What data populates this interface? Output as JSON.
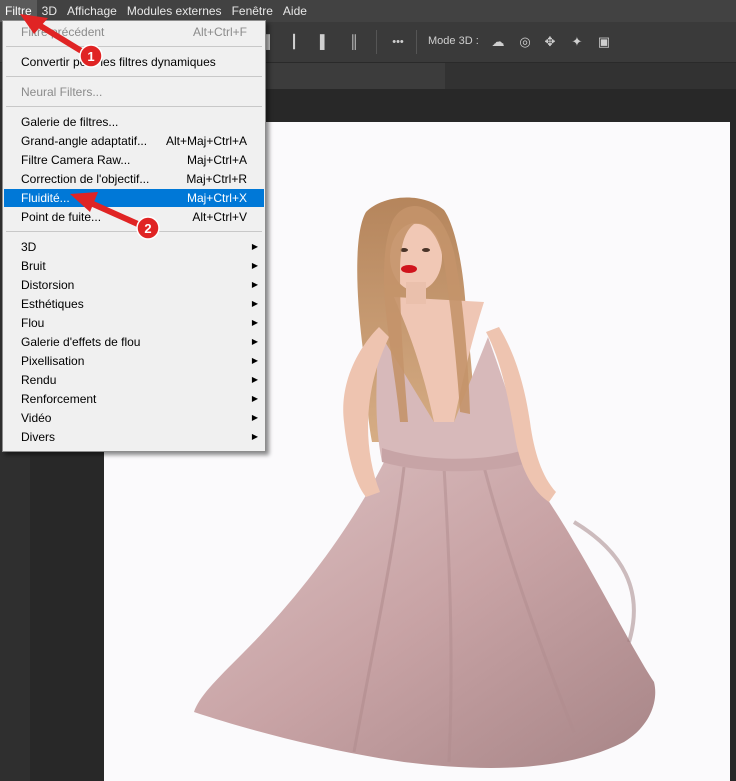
{
  "menubar": {
    "items": [
      {
        "label": "Filtre"
      },
      {
        "label": "3D"
      },
      {
        "label": "Affichage"
      },
      {
        "label": "Modules externes"
      },
      {
        "label": "Fenêtre"
      },
      {
        "label": "Aide"
      }
    ]
  },
  "options_bar": {
    "more_label": "•••",
    "mode3d_label": "Mode 3D :",
    "icons": [
      "align-left-icon",
      "align-center-icon",
      "align-right-icon",
      "distribute-icon",
      "orbit-3d-icon",
      "roll-3d-icon",
      "drag-3d-icon",
      "slide-3d-icon",
      "video-camera-icon"
    ]
  },
  "filter_menu": {
    "last_filter": {
      "label": "Filtre précédent",
      "shortcut": "Alt+Ctrl+F"
    },
    "convert_smart": {
      "label": "Convertir pour les filtres dynamiques"
    },
    "neural": {
      "label": "Neural Filters..."
    },
    "gallery": {
      "label": "Galerie de filtres..."
    },
    "wide_angle": {
      "label": "Grand-angle adaptatif...",
      "shortcut": "Alt+Maj+Ctrl+A"
    },
    "camera_raw": {
      "label": "Filtre Camera Raw...",
      "shortcut": "Maj+Ctrl+A"
    },
    "lens": {
      "label": "Correction de l'objectif...",
      "shortcut": "Maj+Ctrl+R"
    },
    "liquify": {
      "label": "Fluidité...",
      "shortcut": "Maj+Ctrl+X"
    },
    "vanishing": {
      "label": "Point de fuite...",
      "shortcut": "Alt+Ctrl+V"
    },
    "submenus": [
      {
        "label": "3D"
      },
      {
        "label": "Bruit"
      },
      {
        "label": "Distorsion"
      },
      {
        "label": "Esthétiques"
      },
      {
        "label": "Flou"
      },
      {
        "label": "Galerie d'effets de flou"
      },
      {
        "label": "Pixellisation"
      },
      {
        "label": "Rendu"
      },
      {
        "label": "Renforcement"
      },
      {
        "label": "Vidéo"
      },
      {
        "label": "Divers"
      }
    ],
    "submenu_arrow": "▶",
    "highlight_color": "#0078d7"
  },
  "annotations": [
    {
      "number": "1"
    },
    {
      "number": "2"
    }
  ],
  "colors": {
    "arrow": "#e02424",
    "badge": "#e02424"
  }
}
